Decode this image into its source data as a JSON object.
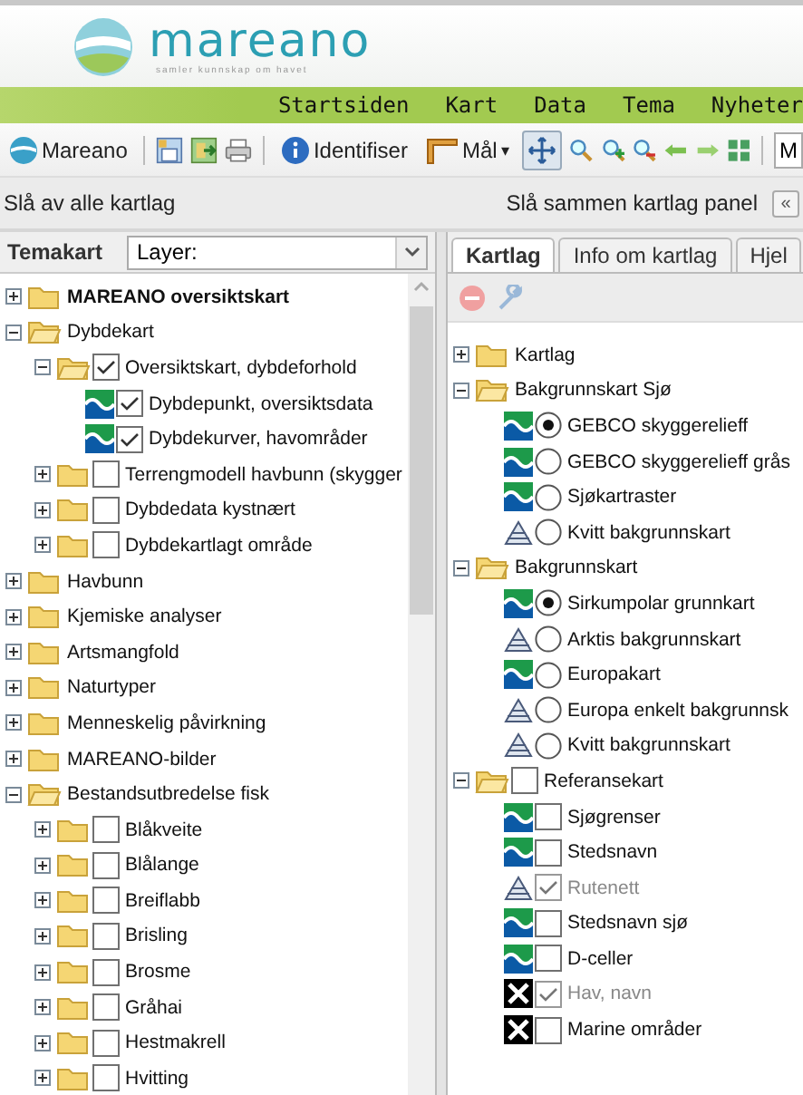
{
  "header": {
    "logo_text": "mareano",
    "tagline": "samler kunnskap om havet"
  },
  "nav": [
    "Startsiden",
    "Kart",
    "Data",
    "Tema",
    "Nyheter"
  ],
  "toolbar": {
    "brand": "Mareano",
    "identify": "Identifiser",
    "measure": "Mål",
    "caret": "▾",
    "pan_selected": true,
    "field": "M"
  },
  "layer_bar": {
    "left": "Slå av alle kartlag",
    "right": "Slå sammen kartlag panel",
    "collapse": "«"
  },
  "theme_panel": {
    "title": "Temakart",
    "select": "Layer:",
    "tree": [
      {
        "label": "MAREANO oversiktskart",
        "kind": "folder",
        "expanded": false,
        "bold": true
      },
      {
        "label": "Dybdekart",
        "kind": "folder",
        "expanded": true,
        "children": [
          {
            "label": "Oversiktskart, dybdeforhold",
            "kind": "folder",
            "expanded": true,
            "checked": true,
            "children": [
              {
                "label": "Dybdepunkt, oversiktsdata",
                "kind": "wave",
                "checked": true
              },
              {
                "label": "Dybdekurver, havområder",
                "kind": "wave",
                "checked": true
              }
            ]
          },
          {
            "label": "Terrengmodell havbunn (skygger",
            "kind": "folder",
            "expanded": false,
            "checked": false
          },
          {
            "label": "Dybdedata kystnært",
            "kind": "folder",
            "expanded": false,
            "checked": false
          },
          {
            "label": "Dybdekartlagt område",
            "kind": "folder",
            "expanded": false,
            "checked": false
          }
        ]
      },
      {
        "label": "Havbunn",
        "kind": "folder",
        "expanded": false
      },
      {
        "label": "Kjemiske analyser",
        "kind": "folder",
        "expanded": false
      },
      {
        "label": "Artsmangfold",
        "kind": "folder",
        "expanded": false
      },
      {
        "label": "Naturtyper",
        "kind": "folder",
        "expanded": false
      },
      {
        "label": "Menneskelig påvirkning",
        "kind": "folder",
        "expanded": false
      },
      {
        "label": "MAREANO-bilder",
        "kind": "folder",
        "expanded": false
      },
      {
        "label": "Bestandsutbredelse fisk",
        "kind": "folder",
        "expanded": true,
        "children": [
          {
            "label": "Blåkveite",
            "kind": "folder",
            "expanded": false,
            "checked": false
          },
          {
            "label": "Blålange",
            "kind": "folder",
            "expanded": false,
            "checked": false
          },
          {
            "label": "Breiflabb",
            "kind": "folder",
            "expanded": false,
            "checked": false
          },
          {
            "label": "Brisling",
            "kind": "folder",
            "expanded": false,
            "checked": false
          },
          {
            "label": "Brosme",
            "kind": "folder",
            "expanded": false,
            "checked": false
          },
          {
            "label": "Gråhai",
            "kind": "folder",
            "expanded": false,
            "checked": false
          },
          {
            "label": "Hestmakrell",
            "kind": "folder",
            "expanded": false,
            "checked": false
          },
          {
            "label": "Hvitting",
            "kind": "folder",
            "expanded": false,
            "checked": false
          }
        ]
      }
    ]
  },
  "layer_panel": {
    "tabs": [
      {
        "label": "Kartlag",
        "selected": true
      },
      {
        "label": "Info om kartlag",
        "selected": false
      },
      {
        "label": "Hjel",
        "selected": false
      }
    ],
    "tree": [
      {
        "label": "Kartlag",
        "kind": "folder",
        "expanded": false
      },
      {
        "label": "Bakgrunnskart Sjø",
        "kind": "folder",
        "expanded": true,
        "children": [
          {
            "label": "GEBCO skyggerelieff",
            "kind": "wave",
            "selected": true
          },
          {
            "label": "GEBCO skyggerelieff grås",
            "kind": "wave",
            "selected": false
          },
          {
            "label": "Sjøkartraster",
            "kind": "wave",
            "selected": false
          },
          {
            "label": "Kvitt bakgrunnskart",
            "kind": "mountain",
            "selected": false
          }
        ]
      },
      {
        "label": "Bakgrunnskart",
        "kind": "folder",
        "expanded": true,
        "children": [
          {
            "label": "Sirkumpolar grunnkart",
            "kind": "wave",
            "selected": true
          },
          {
            "label": "Arktis bakgrunnskart",
            "kind": "mountain",
            "selected": false
          },
          {
            "label": "Europakart",
            "kind": "wave",
            "selected": false
          },
          {
            "label": "Europa enkelt bakgrunnsk",
            "kind": "mountain",
            "selected": false
          },
          {
            "label": "Kvitt bakgrunnskart",
            "kind": "mountain",
            "selected": false
          }
        ]
      },
      {
        "label": "Referansekart",
        "kind": "folder",
        "expanded": true,
        "checked": false,
        "children": [
          {
            "label": "Sjøgrenser",
            "kind": "wave",
            "checked": false,
            "disabled": false
          },
          {
            "label": "Stedsnavn",
            "kind": "wave",
            "checked": false,
            "disabled": false
          },
          {
            "label": "Rutenett",
            "kind": "mountain",
            "checked": true,
            "disabled": true
          },
          {
            "label": "Stedsnavn sjø",
            "kind": "wave",
            "checked": false,
            "disabled": false
          },
          {
            "label": "D-celler",
            "kind": "wave",
            "checked": false,
            "disabled": false
          },
          {
            "label": "Hav, navn",
            "kind": "tools",
            "checked": true,
            "disabled": true
          },
          {
            "label": "Marine områder",
            "kind": "tools",
            "checked": false,
            "disabled": false
          }
        ]
      }
    ]
  }
}
